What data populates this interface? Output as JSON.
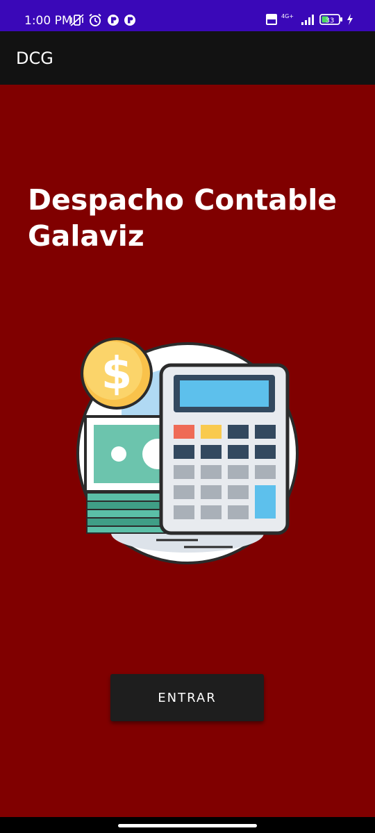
{
  "status_bar": {
    "time": "1:00 PM",
    "network": "4G+",
    "battery": "33",
    "icons": [
      "vibrate-off-icon",
      "alarm-icon",
      "app-notification-icon",
      "app-notification-icon",
      "volte-icon",
      "signal-icon",
      "battery-icon",
      "charging-icon"
    ]
  },
  "app_bar": {
    "title": "DCG"
  },
  "main": {
    "heading": "Despacho Contable Galaviz",
    "illustration": "calculator-money-icon",
    "enter_button": "ENTRAR"
  },
  "colors": {
    "status_bar": "#3a08b8",
    "app_bar": "#121212",
    "background": "#800000",
    "button": "#1e1e1e"
  }
}
